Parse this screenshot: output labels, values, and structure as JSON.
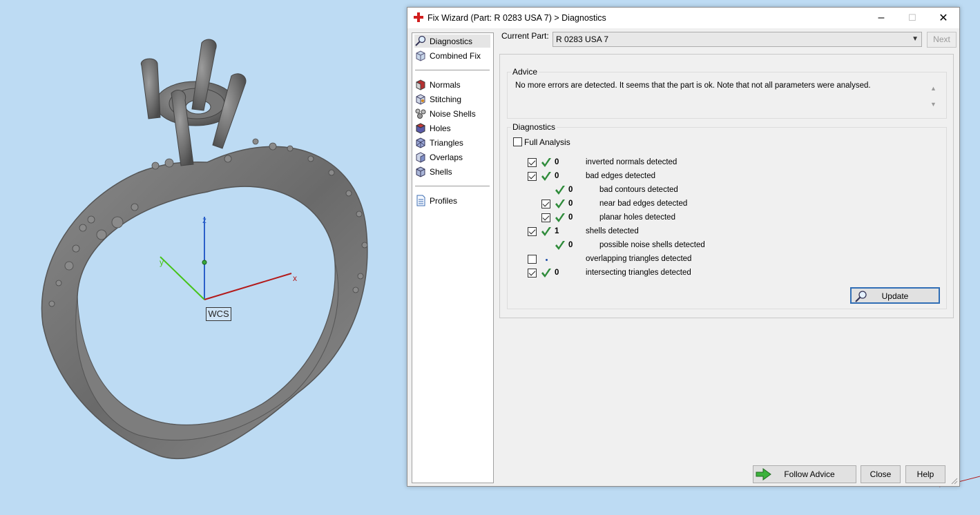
{
  "viewport": {
    "axis_x": "x",
    "axis_y": "y",
    "axis_z": "z",
    "wcs_label": "WCS"
  },
  "window": {
    "title": "Fix Wizard (Part: R 0283 USA 7) > Diagnostics",
    "minimize_glyph": "–",
    "maximize_glyph": "☐",
    "close_glyph": "✕"
  },
  "nav": {
    "top": [
      {
        "label": "Diagnostics",
        "icon": "magnifier-icon"
      },
      {
        "label": "Combined Fix",
        "icon": "cube-icon"
      }
    ],
    "fixes": [
      {
        "label": "Normals",
        "icon": "normals-cube-icon"
      },
      {
        "label": "Stitching",
        "icon": "stitching-cube-icon"
      },
      {
        "label": "Noise Shells",
        "icon": "noise-shells-icon"
      },
      {
        "label": "Holes",
        "icon": "holes-cube-icon"
      },
      {
        "label": "Triangles",
        "icon": "triangles-cube-icon"
      },
      {
        "label": "Overlaps",
        "icon": "overlaps-cube-icon"
      },
      {
        "label": "Shells",
        "icon": "shells-cube-icon"
      }
    ],
    "bottom": [
      {
        "label": "Profiles",
        "icon": "document-icon"
      }
    ]
  },
  "current_part": {
    "label": "Current Part:",
    "value": "R 0283 USA 7",
    "next_label": "Next"
  },
  "advice": {
    "title": "Advice",
    "text": "No more errors are detected. It seems that the part is ok. Note that not all parameters were analysed."
  },
  "diagnostics": {
    "title": "Diagnostics",
    "full_analysis_label": "Full Analysis",
    "rows": [
      {
        "checkbox": true,
        "checked": true,
        "ok": true,
        "count": "0",
        "label": "inverted normals detected",
        "indent": 0
      },
      {
        "checkbox": true,
        "checked": true,
        "ok": true,
        "count": "0",
        "label": "bad edges detected",
        "indent": 0
      },
      {
        "checkbox": false,
        "checked": false,
        "ok": true,
        "count": "0",
        "label": "bad contours detected",
        "indent": 1
      },
      {
        "checkbox": true,
        "checked": true,
        "ok": true,
        "count": "0",
        "label": "near bad edges detected",
        "indent": 1
      },
      {
        "checkbox": true,
        "checked": true,
        "ok": true,
        "count": "0",
        "label": "planar holes detected",
        "indent": 1
      },
      {
        "checkbox": true,
        "checked": true,
        "ok": true,
        "count": "1",
        "label": "shells detected",
        "indent": 0
      },
      {
        "checkbox": false,
        "checked": false,
        "ok": true,
        "count": "0",
        "label": "possible noise shells detected",
        "indent": 1
      },
      {
        "checkbox": true,
        "checked": false,
        "ok": false,
        "count": "",
        "label": "overlapping triangles detected",
        "indent": 0
      },
      {
        "checkbox": true,
        "checked": true,
        "ok": true,
        "count": "0",
        "label": "intersecting triangles detected",
        "indent": 0
      }
    ],
    "update_label": "Update"
  },
  "footer": {
    "follow_advice_label": "Follow Advice",
    "close_label": "Close",
    "help_label": "Help"
  },
  "colors": {
    "ok_check": "#2e8b3a",
    "accent": "#2f6db5",
    "viewport_bg": "#bddbf3"
  }
}
